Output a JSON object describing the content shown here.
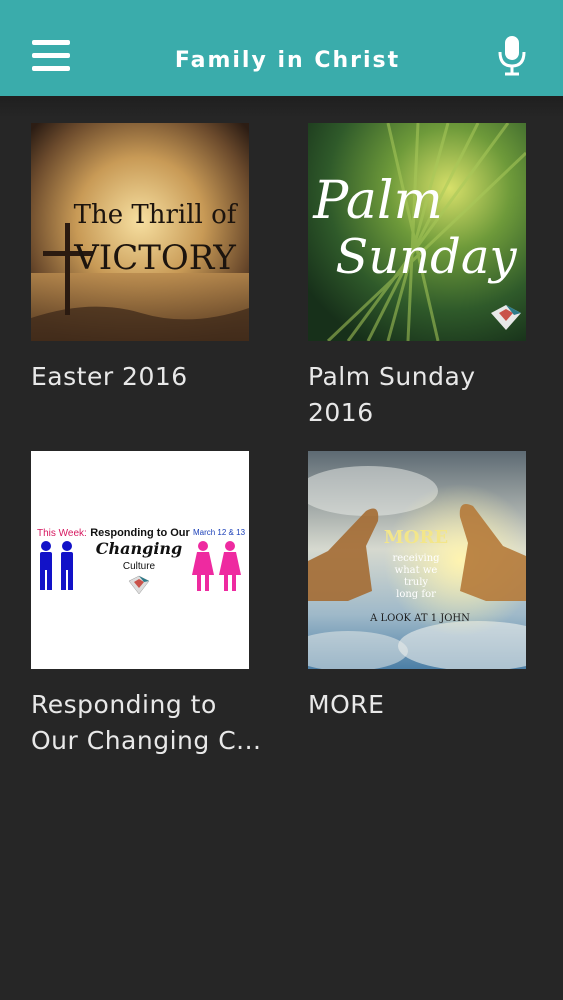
{
  "header": {
    "title": "Family in Christ",
    "menu_icon": "hamburger-menu-icon",
    "mic_icon": "microphone-icon",
    "color": "#3aacab"
  },
  "series": [
    {
      "title": "Easter 2016",
      "art": {
        "line1": "The Thrill of",
        "line2": "VICTORY"
      }
    },
    {
      "title": "Palm Sunday 2016",
      "art": {
        "line1": "Palm",
        "line2": "Sunday"
      }
    },
    {
      "title": "Responding to Our Changing C...",
      "art": {
        "this_week": "This Week:",
        "heading": "Responding to Our",
        "changing": "Changing",
        "culture": "Culture",
        "dates": "March 12 & 13"
      }
    },
    {
      "title": "MORE",
      "art": {
        "line1": "MORE",
        "line2": "receiving",
        "line3": "what we",
        "line4": "truly",
        "line5": "long for",
        "line6": "A LOOK AT 1 JOHN"
      }
    }
  ]
}
